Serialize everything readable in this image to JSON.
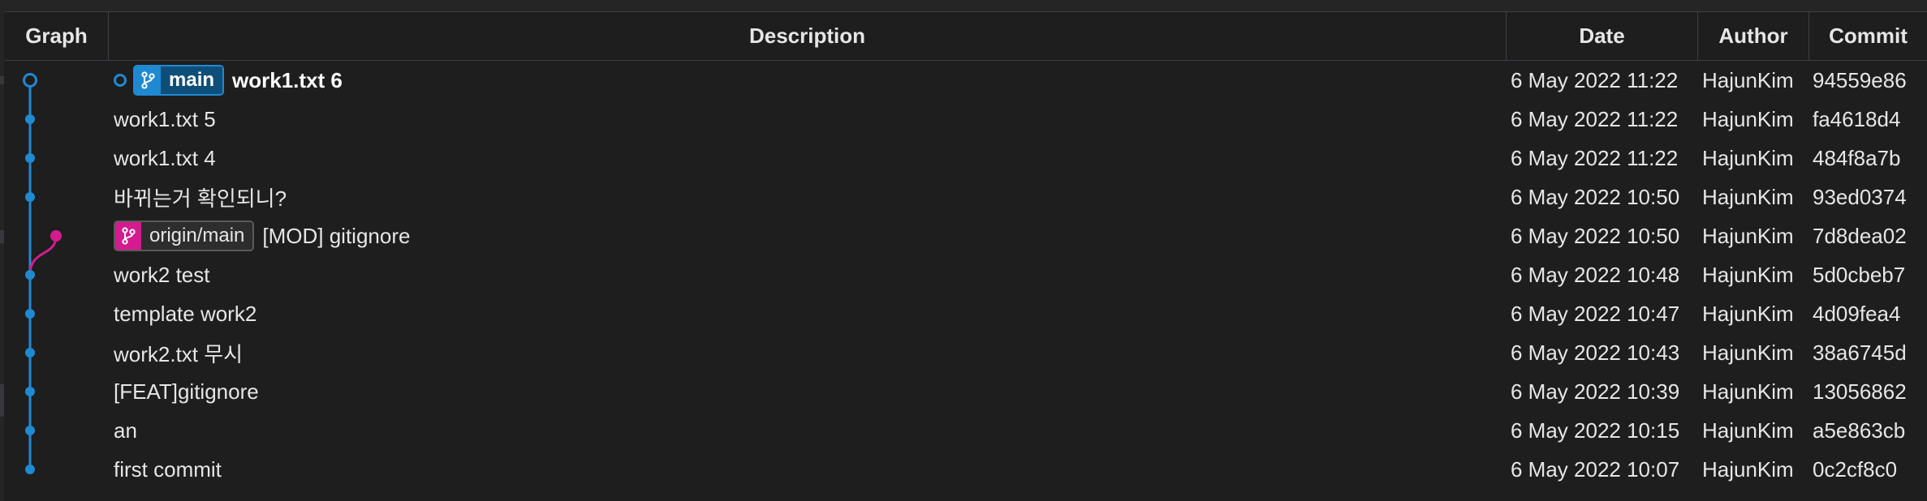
{
  "columns": {
    "graph": "Graph",
    "description": "Description",
    "date": "Date",
    "author": "Author",
    "commit": "Commit"
  },
  "colors": {
    "main_branch": "#1f8ad2",
    "origin_branch": "#d41b8f"
  },
  "commits": [
    {
      "message": "work1.txt 6",
      "date": "6 May 2022 11:22",
      "author": "HajunKim",
      "hash": "94559e86",
      "is_head": true,
      "branch_label": "main",
      "branch_icon": "git-branch-icon"
    },
    {
      "message": "work1.txt 5",
      "date": "6 May 2022 11:22",
      "author": "HajunKim",
      "hash": "fa4618d4"
    },
    {
      "message": "work1.txt 4",
      "date": "6 May 2022 11:22",
      "author": "HajunKim",
      "hash": "484f8a7b"
    },
    {
      "message": "바뀌는거 확인되니?",
      "date": "6 May 2022 10:50",
      "author": "HajunKim",
      "hash": "93ed0374"
    },
    {
      "message": "[MOD] gitignore",
      "date": "6 May 2022 10:50",
      "author": "HajunKim",
      "hash": "7d8dea02",
      "branch_label": "origin/main",
      "branch_icon": "git-branch-icon"
    },
    {
      "message": "work2 test",
      "date": "6 May 2022 10:48",
      "author": "HajunKim",
      "hash": "5d0cbeb7"
    },
    {
      "message": "template work2",
      "date": "6 May 2022 10:47",
      "author": "HajunKim",
      "hash": "4d09fea4"
    },
    {
      "message": "work2.txt 무시",
      "date": "6 May 2022 10:43",
      "author": "HajunKim",
      "hash": "38a6745d"
    },
    {
      "message": "[FEAT]gitignore",
      "date": "6 May 2022 10:39",
      "author": "HajunKim",
      "hash": "13056862"
    },
    {
      "message": "an",
      "date": "6 May 2022 10:15",
      "author": "HajunKim",
      "hash": "a5e863cb"
    },
    {
      "message": "first commit",
      "date": "6 May 2022 10:07",
      "author": "HajunKim",
      "hash": "0c2cf8c0"
    }
  ]
}
